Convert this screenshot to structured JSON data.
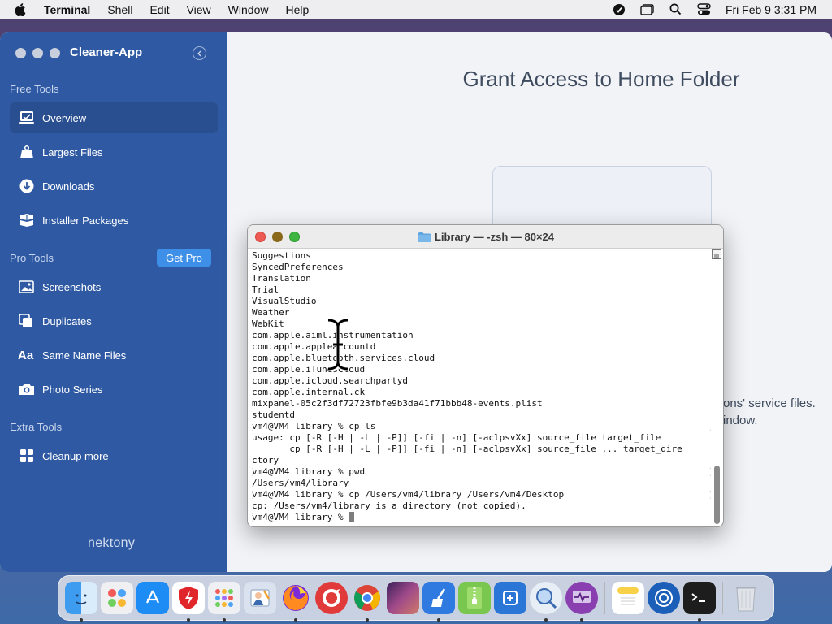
{
  "menubar": {
    "app_name": "Terminal",
    "items": [
      "Shell",
      "Edit",
      "View",
      "Window",
      "Help"
    ],
    "clock": "Fri Feb 9  3:31 PM"
  },
  "cleaner": {
    "title": "Cleaner-App",
    "sections": {
      "free": "Free Tools",
      "pro": "Pro Tools",
      "extra": "Extra Tools"
    },
    "free_items": [
      "Overview",
      "Largest Files",
      "Downloads",
      "Installer Packages"
    ],
    "pro_items": [
      "Screenshots",
      "Duplicates",
      "Same Name Files",
      "Photo Series"
    ],
    "extra_items": [
      "Cleanup more"
    ],
    "get_pro_label": "Get Pro",
    "brand": "nektony",
    "main_title": "Grant Access to Home Folder",
    "partial_text_1": "ons' service files.",
    "partial_text_2": "indow."
  },
  "terminal": {
    "title": "Library — -zsh — 80×24",
    "lines": [
      "Suggestions",
      "SyncedPreferences",
      "Translation",
      "Trial",
      "VisualStudio",
      "Weather",
      "WebKit",
      "com.apple.aiml.instrumentation",
      "com.apple.appleaccountd",
      "com.apple.bluetooth.services.cloud",
      "com.apple.iTunesCloud",
      "com.apple.icloud.searchpartyd",
      "com.apple.internal.ck",
      "mixpanel-05c2f3df72723fbfe9b3da41f71bbb48-events.plist",
      "studentd",
      "vm4@VM4 library % cp ls",
      "usage: cp [-R [-H | -L | -P]] [-fi | -n] [-aclpsvXx] source_file target_file",
      "       cp [-R [-H | -L | -P]] [-fi | -n] [-aclpsvXx] source_file ... target_dire",
      "ctory",
      "vm4@VM4 library % pwd",
      "/Users/vm4/library",
      "vm4@VM4 library % cp /Users/vm4/library /Users/vm4/Desktop",
      "cp: /Users/vm4/library is a directory (not copied).",
      "vm4@VM4 library % "
    ]
  },
  "dock": {
    "apps": [
      "Finder",
      "Launchpad",
      "App Store",
      "Security",
      "Apps",
      "Preview",
      "Firefox",
      "Opera",
      "Chrome",
      "Photo Slideshow",
      "Cleaner",
      "Archiver",
      "Screen Tool",
      "Disk Inspector",
      "Activity Monitor",
      "Notes",
      "Browser",
      "Terminal",
      "Trash"
    ]
  }
}
